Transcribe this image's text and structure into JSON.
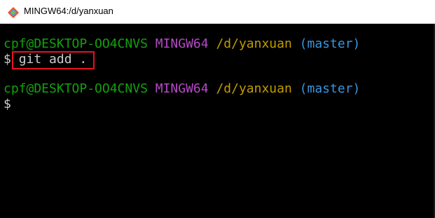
{
  "window": {
    "title": "MINGW64:/d/yanxuan",
    "icon": "git-bash-icon"
  },
  "terminal": {
    "prompts": [
      {
        "user_host": "cpf@DESKTOP-OO4CNVS",
        "shell": "MINGW64",
        "path": "/d/yanxuan",
        "branch": "(master)",
        "symbol": "$",
        "command": "git add ."
      },
      {
        "user_host": "cpf@DESKTOP-OO4CNVS",
        "shell": "MINGW64",
        "path": "/d/yanxuan",
        "branch": "(master)",
        "symbol": "$",
        "command": ""
      }
    ]
  },
  "colors": {
    "user_host": "#13a10e",
    "shell": "#b548c6",
    "path": "#c19c00",
    "branch": "#3a96dd",
    "highlight_box": "#e81123"
  }
}
